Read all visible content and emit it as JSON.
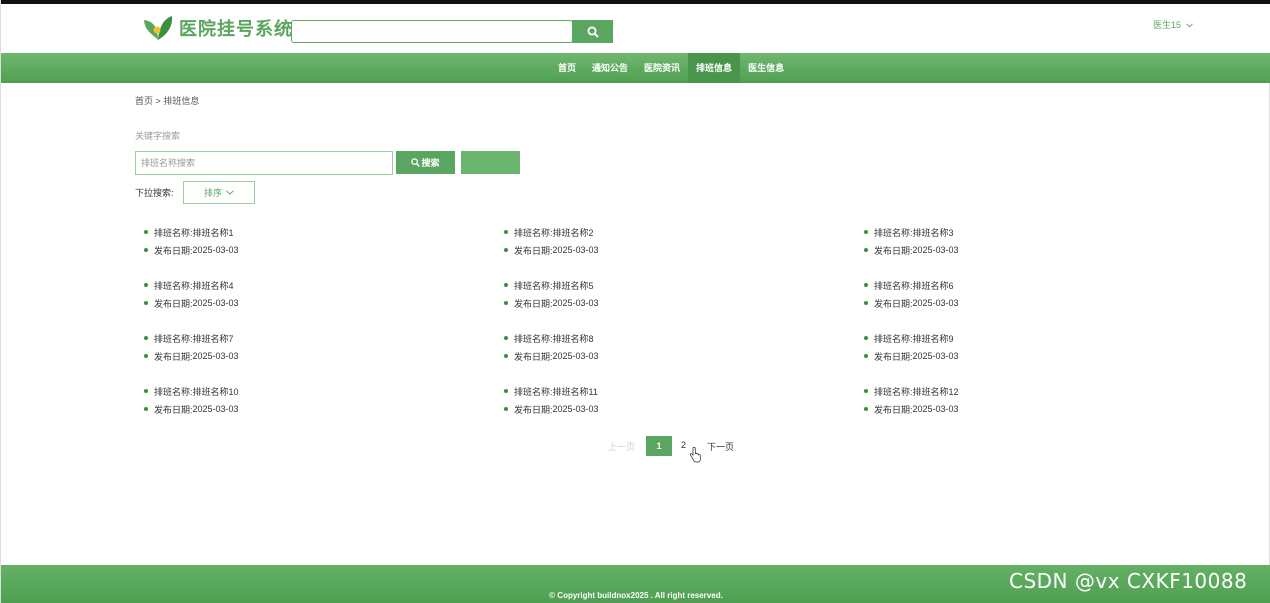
{
  "header": {
    "app_title": "医院挂号系统",
    "search_placeholder": "",
    "user_label": "医生15",
    "brand_color": "#5aa55f"
  },
  "nav": {
    "items": [
      {
        "label": "首页",
        "active": false
      },
      {
        "label": "通知公告",
        "active": false
      },
      {
        "label": "医院资讯",
        "active": false
      },
      {
        "label": "排班信息",
        "active": true
      },
      {
        "label": "医生信息",
        "active": false
      }
    ]
  },
  "breadcrumb": {
    "home": "首页",
    "separator": ">",
    "current": "排班信息"
  },
  "filters": {
    "keyword_label": "关键字搜索",
    "keyword_placeholder": "排班名称搜索",
    "search_button": "搜索",
    "dropdown_label": "下拉搜索:",
    "dropdown_value": "排序"
  },
  "items": [
    {
      "name_label": "排班名称:",
      "name": "排班名称1",
      "date_label": "发布日期:",
      "date": "2025-03-03"
    },
    {
      "name_label": "排班名称:",
      "name": "排班名称2",
      "date_label": "发布日期:",
      "date": "2025-03-03"
    },
    {
      "name_label": "排班名称:",
      "name": "排班名称3",
      "date_label": "发布日期:",
      "date": "2025-03-03"
    },
    {
      "name_label": "排班名称:",
      "name": "排班名称4",
      "date_label": "发布日期:",
      "date": "2025-03-03"
    },
    {
      "name_label": "排班名称:",
      "name": "排班名称5",
      "date_label": "发布日期:",
      "date": "2025-03-03"
    },
    {
      "name_label": "排班名称:",
      "name": "排班名称6",
      "date_label": "发布日期:",
      "date": "2025-03-03"
    },
    {
      "name_label": "排班名称:",
      "name": "排班名称7",
      "date_label": "发布日期:",
      "date": "2025-03-03"
    },
    {
      "name_label": "排班名称:",
      "name": "排班名称8",
      "date_label": "发布日期:",
      "date": "2025-03-03"
    },
    {
      "name_label": "排班名称:",
      "name": "排班名称9",
      "date_label": "发布日期:",
      "date": "2025-03-03"
    },
    {
      "name_label": "排班名称:",
      "name": "排班名称10",
      "date_label": "发布日期:",
      "date": "2025-03-03"
    },
    {
      "name_label": "排班名称:",
      "name": "排班名称11",
      "date_label": "发布日期:",
      "date": "2025-03-03"
    },
    {
      "name_label": "排班名称:",
      "name": "排班名称12",
      "date_label": "发布日期:",
      "date": "2025-03-03"
    }
  ],
  "pagination": {
    "prev": "上一页",
    "page1": "1",
    "page2": "2",
    "next": "下一页",
    "current": 1
  },
  "footer": {
    "copyright": "© Copyright buildnox2025 . All right reserved."
  },
  "watermark": "CSDN @vx  CXKF10088"
}
